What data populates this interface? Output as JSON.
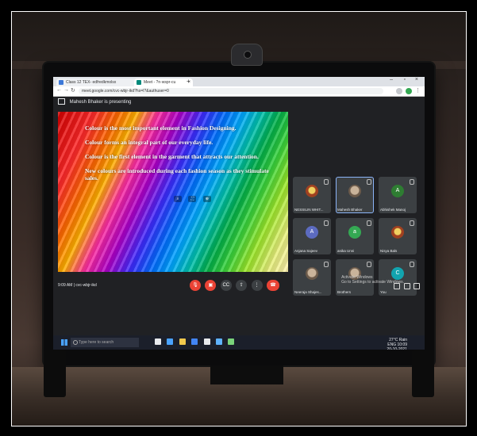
{
  "browser": {
    "tabs": [
      {
        "label": "Class 12 TEX- edfredkmolsx"
      },
      {
        "label": "Meet - ?n·wspr-cu"
      }
    ],
    "address": "meet.google.com/cvc-wbjr-ikd?hs=I?&authuser=0"
  },
  "meet": {
    "presenting_text": "Mahesh Bhaker is presenting",
    "slide_lines": [
      "Colour is the most important element in Fashion Designing.",
      "Colour forms an integral part of our everyday life.",
      "Colour is the first element in the garment that attracts our attention.",
      "New colours are introduced during each fashion season as they stimulate sales."
    ],
    "participants": [
      {
        "name": "NESSILIN WHIT..."
      },
      {
        "name": "Mahesh Bhaker"
      },
      {
        "name": "Abhishek Manoj",
        "initial": "A"
      },
      {
        "name": "Anjana Sajeev",
        "initial": "A"
      },
      {
        "name": "anika Unni",
        "initial": "a"
      },
      {
        "name": "Nisya Bals"
      },
      {
        "name": "Neeraja Shajes..."
      },
      {
        "name": "Brothers"
      },
      {
        "name": "You",
        "initial": "C"
      }
    ],
    "meeting_meta": "9:09 AM | cvc-wbjr-ikd",
    "activate": {
      "line1": "Activate Windows",
      "line2": "Go to Settings to activate Windows."
    }
  },
  "taskbar": {
    "search_placeholder": "Type here to search",
    "tray_top": "10:09",
    "tray_bottom": "20-10-2021",
    "weather": "27°C Rain",
    "lang": "ENG"
  },
  "colors": {
    "meet_bg": "#202124",
    "tile_bg": "#3c4043",
    "end_call": "#ea4335",
    "avatar_blue": "#5c6bc0",
    "avatar_green": "#34a853",
    "avatar_teal": "#12a4af"
  }
}
